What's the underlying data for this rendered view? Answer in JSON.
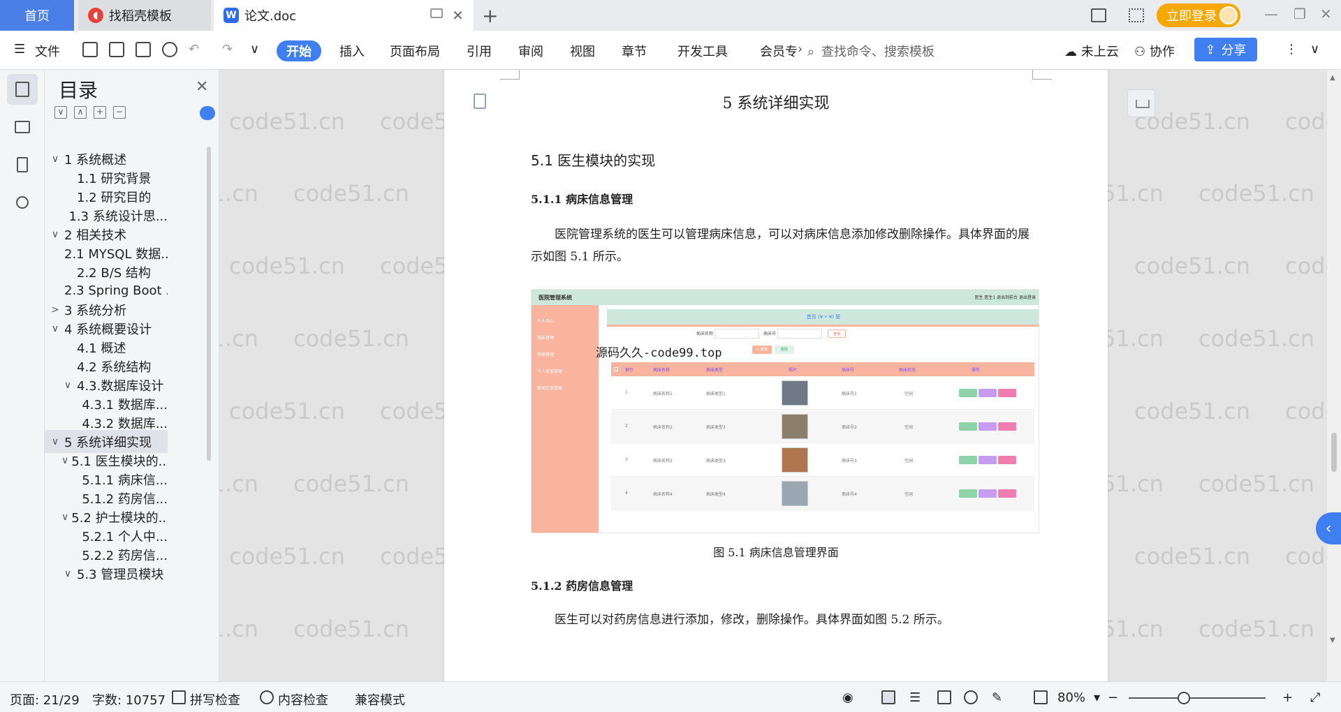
{
  "tabs": {
    "home": "首页",
    "template": "找稻壳模板",
    "doc": "论文.doc",
    "template_icon": "daoke-logo-icon",
    "doc_icon": "wps-writer-icon"
  },
  "titlebar": {
    "login_label": "立即登录",
    "add_tab": "+"
  },
  "toolbar": {
    "file": "文件",
    "tabs": [
      "开始",
      "插入",
      "页面布局",
      "引用",
      "审阅",
      "视图",
      "章节",
      "开发工具",
      "会员专"
    ],
    "search_placeholder": "查找命令、搜索模板",
    "cloud": "未上云",
    "collab": "协作",
    "share": "分享"
  },
  "toc": {
    "title": "目录",
    "items": [
      {
        "label": "1 系统概述",
        "arrow": "∨"
      },
      {
        "label": "1.1  研究背景",
        "arrow": ""
      },
      {
        "label": "1.2 研究目的",
        "arrow": ""
      },
      {
        "label": "1.3 系统设计思...",
        "arrow": ""
      },
      {
        "label": "2 相关技术",
        "arrow": "∨"
      },
      {
        "label": "2.1 MYSQL 数据...",
        "arrow": ""
      },
      {
        "label": "2.2 B/S 结构",
        "arrow": ""
      },
      {
        "label": "2.3 Spring Boot ...",
        "arrow": ""
      },
      {
        "label": "3 系统分析",
        "arrow": ">"
      },
      {
        "label": "4 系统概要设计",
        "arrow": "∨"
      },
      {
        "label": "4.1 概述",
        "arrow": ""
      },
      {
        "label": "4.2 系统结构",
        "arrow": ""
      },
      {
        "label": "4.3.数据库设计",
        "arrow": "∨"
      },
      {
        "label": "4.3.1 数据库...",
        "arrow": ""
      },
      {
        "label": "4.3.2 数据库...",
        "arrow": ""
      },
      {
        "label": "5 系统详细实现",
        "arrow": "∨"
      },
      {
        "label": "5.1  医生模块的...",
        "arrow": "∨"
      },
      {
        "label": "5.1.1  病床信...",
        "arrow": ""
      },
      {
        "label": "5.1.2  药房信...",
        "arrow": ""
      },
      {
        "label": "5.2  护士模块的...",
        "arrow": "∨"
      },
      {
        "label": "5.2.1  个人中...",
        "arrow": ""
      },
      {
        "label": "5.2.2  药房信...",
        "arrow": ""
      },
      {
        "label": "5.3  管理员模块",
        "arrow": "∨"
      }
    ]
  },
  "document": {
    "chapter_title": "5 系统详细实现",
    "section_title": "5.1  医生模块的实现",
    "sub1_title": "5.1.1  病床信息管理",
    "sub1_para": "医院管理系统的医生可以管理病床信息，可以对病床信息添加修改删除操作。具体界面的展示如图 5.1 所示。",
    "figure_caption": "图 5.1  病床信息管理界面",
    "sub2_title": "5.1.2  药房信息管理",
    "sub2_para": "医生可以对药房信息进行添加，修改，删除操作。具体界面如图 5.2 所示。"
  },
  "figure": {
    "app_title": "医院管理系统",
    "header_right": "医生 医生1  退出到前台  退出登录",
    "breadcrumb": "首页 (¥ • ¥) 管",
    "search_label_1": "病床名称",
    "search_label_2": "病床号",
    "search_btn": "查询",
    "add_btn": "+ 新增",
    "del_btn": "删除",
    "overlay": "源码久久-code99.top",
    "headers": [
      "索引",
      "病床名称",
      "病床类型",
      "照片",
      "病床号",
      "病床状态",
      "操作"
    ],
    "rows": [
      {
        "idx": "1",
        "name": "病床名称1",
        "type": "病床类型1",
        "no": "病床号1",
        "status": "空闲"
      },
      {
        "idx": "2",
        "name": "病床名称2",
        "type": "病床类型2",
        "no": "病床号2",
        "status": "空闲"
      },
      {
        "idx": "3",
        "name": "病床名称3",
        "type": "病床类型3",
        "no": "病床号3",
        "status": "空闲"
      },
      {
        "idx": "4",
        "name": "病床名称4",
        "type": "病床类型4",
        "no": "病床号4",
        "status": "空闲"
      }
    ],
    "side_items": [
      "个人中心",
      "病床管理",
      "药房管理",
      "个人信息管理",
      "新闻信息管理"
    ]
  },
  "watermark": "code51.cn",
  "statusbar": {
    "page": "页面: 21/29",
    "words": "字数: 10757",
    "spell": "拼写检查",
    "content": "内容检查",
    "compat": "兼容模式",
    "zoom": "80%"
  },
  "colors": {
    "accent": "#3f7ff0",
    "login": "#f7a800",
    "figure_side": "#f8b49e",
    "figure_header": "#cde7dc"
  }
}
